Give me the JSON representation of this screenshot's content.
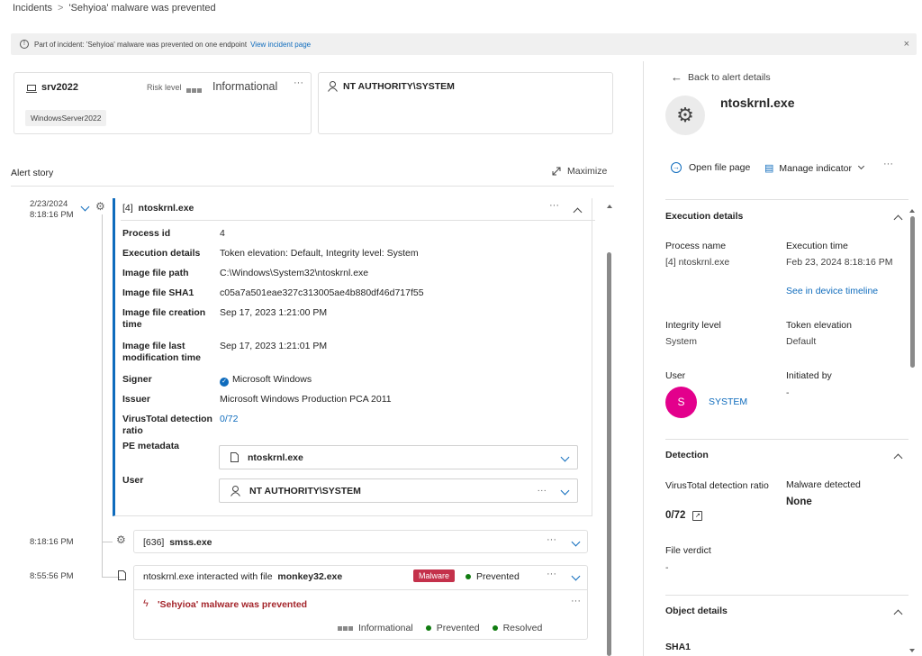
{
  "breadcrumb": {
    "root": "Incidents",
    "sep": ">",
    "current": "'Sehyioa' malware was prevented"
  },
  "banner": {
    "text": "Part of incident: 'Sehyioa' malware was prevented on one endpoint",
    "link": "View incident page",
    "close": "×"
  },
  "device_card": {
    "name": "srv2022",
    "risk_label": "Risk level",
    "risk_value": "Informational",
    "tag": "WindowsServer2022",
    "more": "···"
  },
  "user_card": {
    "name": "NT AUTHORITY\\SYSTEM"
  },
  "alert_story": {
    "title": "Alert story",
    "maximize": "Maximize"
  },
  "main_process": {
    "date": "2/23/2024",
    "time": "8:18:16 PM",
    "id": "[4]",
    "name": "ntoskrnl.exe",
    "more": "···",
    "details": [
      {
        "label": "Process id",
        "value": "4"
      },
      {
        "label": "Execution details",
        "value": "Token elevation: Default, Integrity level: System"
      },
      {
        "label": "Image file path",
        "value": "C:\\Windows\\System32\\ntoskrnl.exe"
      },
      {
        "label": "Image file SHA1",
        "value": "c05a7a501eae327c313005ae4b880df46d717f55"
      },
      {
        "label": "Image file creation time",
        "value": "Sep 17, 2023 1:21:00 PM"
      },
      {
        "label": "Image file last modification time",
        "value": "Sep 17, 2023 1:21:01 PM"
      },
      {
        "label": "Signer",
        "value": "Microsoft Windows"
      },
      {
        "label": "Issuer",
        "value": "Microsoft Windows Production PCA 2011"
      },
      {
        "label": "VirusTotal detection ratio",
        "value": "0/72"
      }
    ],
    "pe_label": "PE metadata",
    "pe_value": "ntoskrnl.exe",
    "user_label": "User",
    "user_value": "NT AUTHORITY\\SYSTEM",
    "user_more": "···"
  },
  "child_process": {
    "time": "8:18:16 PM",
    "id": "[636]",
    "name": "smss.exe",
    "more": "···"
  },
  "file_event": {
    "time": "8:55:56 PM",
    "text": "ntoskrnl.exe interacted with file",
    "file": "monkey32.exe",
    "badge": "Malware",
    "status": "Prevented",
    "more": "···"
  },
  "alert": {
    "title": "'Sehyioa' malware was prevented",
    "severity": "Informational",
    "state1": "Prevented",
    "state2": "Resolved",
    "more": "···"
  },
  "right_panel": {
    "back": "Back to alert details",
    "title": "ntoskrnl.exe",
    "open_file": "Open file page",
    "manage": "Manage indicator",
    "more": "···",
    "exec_header": "Execution details",
    "process_name_label": "Process name",
    "process_name": "[4] ntoskrnl.exe",
    "exec_time_label": "Execution time",
    "exec_time": "Feb 23, 2024 8:18:16 PM",
    "timeline_link": "See in device timeline",
    "integrity_label": "Integrity level",
    "integrity": "System",
    "token_label": "Token elevation",
    "token": "Default",
    "user_label": "User",
    "user_initial": "S",
    "user_name": "SYSTEM",
    "initiated_label": "Initiated by",
    "initiated": "-",
    "detection_header": "Detection",
    "vt_label": "VirusTotal detection ratio",
    "vt_value": "0/72",
    "malware_label": "Malware detected",
    "malware_value": "None",
    "verdict_label": "File verdict",
    "verdict": "-",
    "object_header": "Object details",
    "sha1_label": "SHA1"
  },
  "colors": {
    "accent": "#0f6cbd",
    "malware": "#c4314b",
    "success": "#107c10",
    "avatar": "#e3008c",
    "alert_red": "#a4262c"
  }
}
